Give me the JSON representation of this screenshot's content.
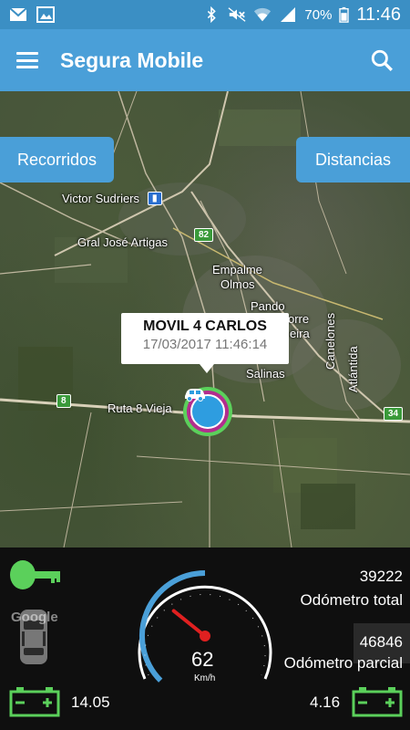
{
  "status_bar": {
    "battery_percent": "70%",
    "time": "11:46",
    "icons": [
      "gmail-icon",
      "gallery-icon",
      "bluetooth-icon",
      "mute-icon",
      "wifi-icon",
      "signal-icon",
      "battery-icon"
    ]
  },
  "app_bar": {
    "title": "Segura Mobile",
    "menu_icon": "menu-icon",
    "search_icon": "search-icon"
  },
  "map": {
    "buttons": {
      "recorridos": "Recorridos",
      "distancias": "Distancias"
    },
    "labels": {
      "victor_sudriers": "Victor Sudriers",
      "gral_jose_artigas": "Gral José Artigas",
      "empalme_olmos_1": "Empalme",
      "empalme_olmos_2": "Olmos",
      "pando": "Pando",
      "salinas": "Salinas",
      "ruta_8_vieja": "Ruta 8 Vieja",
      "atlantida": "Atlántida",
      "canelones": "Canelones",
      "torre": "orre",
      "eira": "eira"
    },
    "shields": {
      "r82": "82",
      "r8": "8",
      "r34": "34"
    },
    "popup": {
      "name": "MOVIL 4 CARLOS",
      "datetime": "17/03/2017 11:46:14"
    },
    "marker_icon": "car-icon",
    "google_logo": "Google"
  },
  "dashboard": {
    "key_icon": "key-icon",
    "car_icon": "car-topview-icon",
    "battery_left_value": "14.05",
    "battery_right_value": "4.16",
    "speed": "62",
    "speed_unit": "Km/h",
    "speed_fraction": 0.5,
    "odometer_total_value": "39222",
    "odometer_total_label": "Odómetro total",
    "odometer_partial_value": "46846",
    "odometer_partial_label": "Odómetro parcial",
    "colors": {
      "accent": "#4a9fd8",
      "battery_green": "#5bd05b",
      "needle": "#e02020"
    }
  }
}
